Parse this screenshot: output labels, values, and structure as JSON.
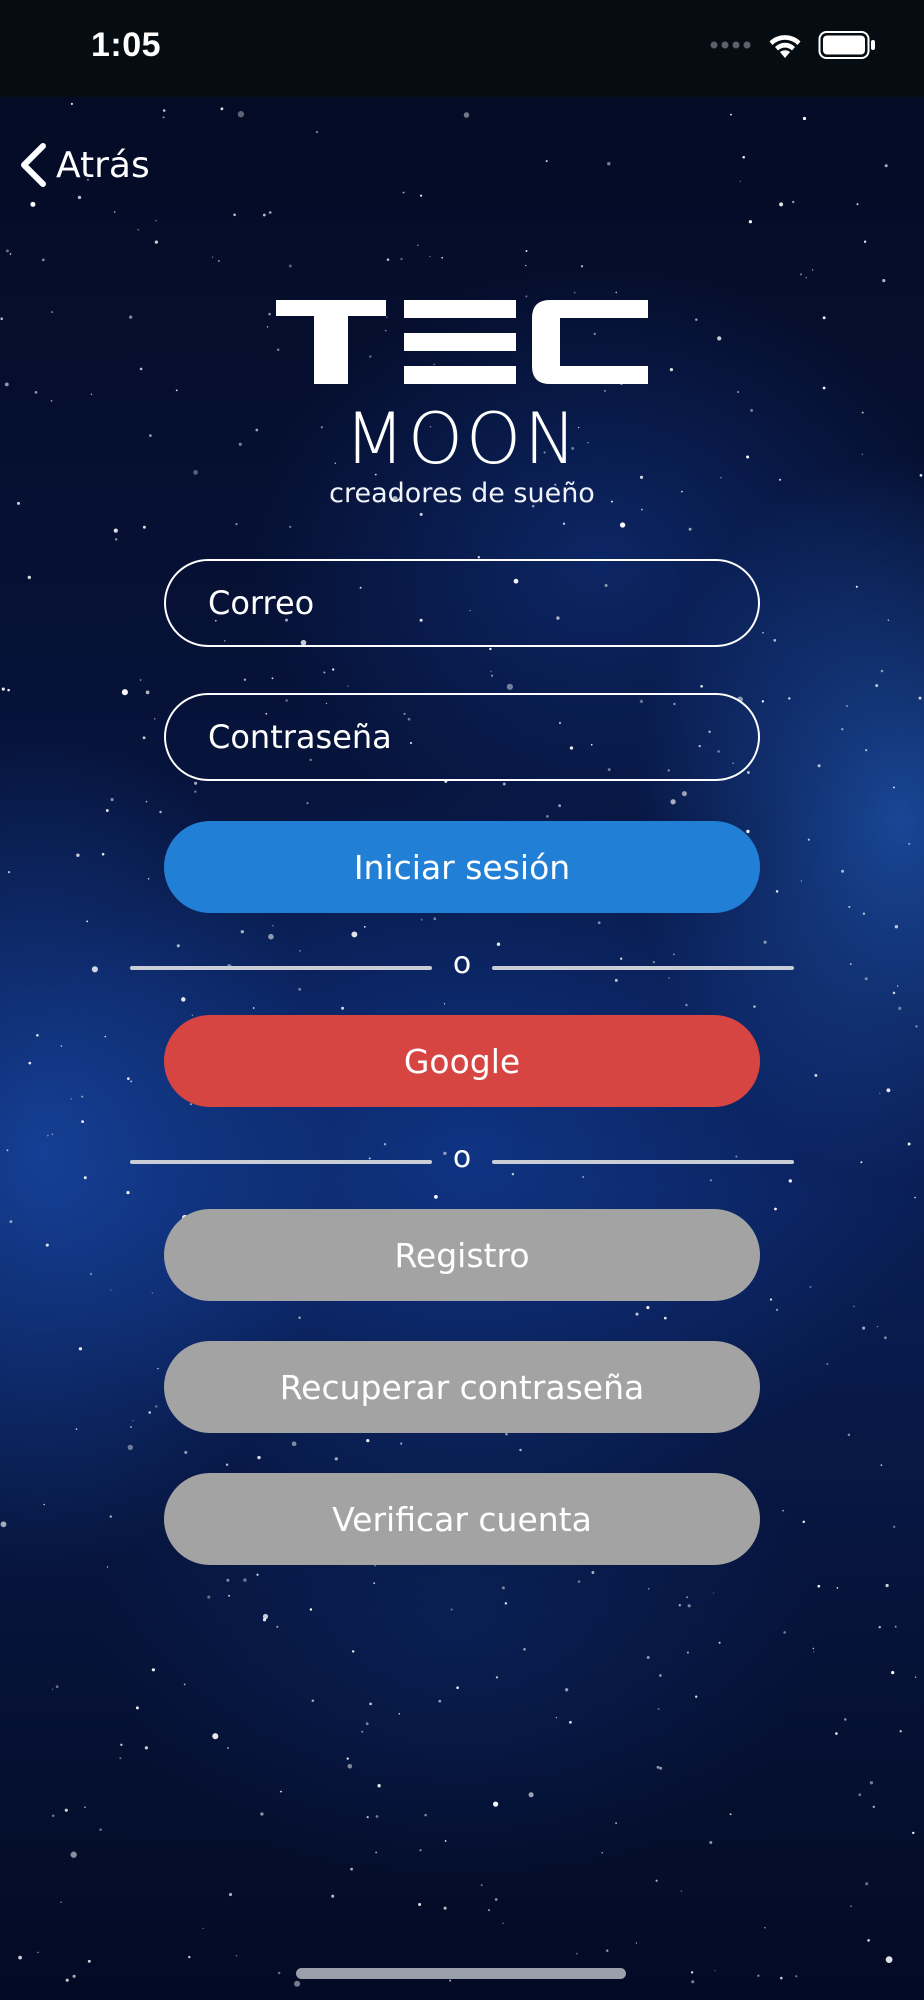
{
  "status_bar": {
    "time": "1:05",
    "icons": [
      "signal-icon",
      "wifi-icon",
      "battery-icon"
    ]
  },
  "nav": {
    "back_label": "Atrás",
    "back_icon": "chevron-left-icon"
  },
  "logo": {
    "wordmark": "TEC",
    "name": "MOON",
    "tagline": "creadores de sueño"
  },
  "form": {
    "email_placeholder": "Correo",
    "password_placeholder": "Contraseña"
  },
  "buttons": {
    "login": "Iniciar sesión",
    "google": "Google",
    "register": "Registro",
    "recover": "Recuperar contraseña",
    "verify": "Verificar cuenta"
  },
  "dividers": {
    "first": "o",
    "second": "o"
  },
  "colors": {
    "login": "#2180d6",
    "google": "#d64541",
    "secondary": "#a3a3a3",
    "background": "#061238"
  }
}
